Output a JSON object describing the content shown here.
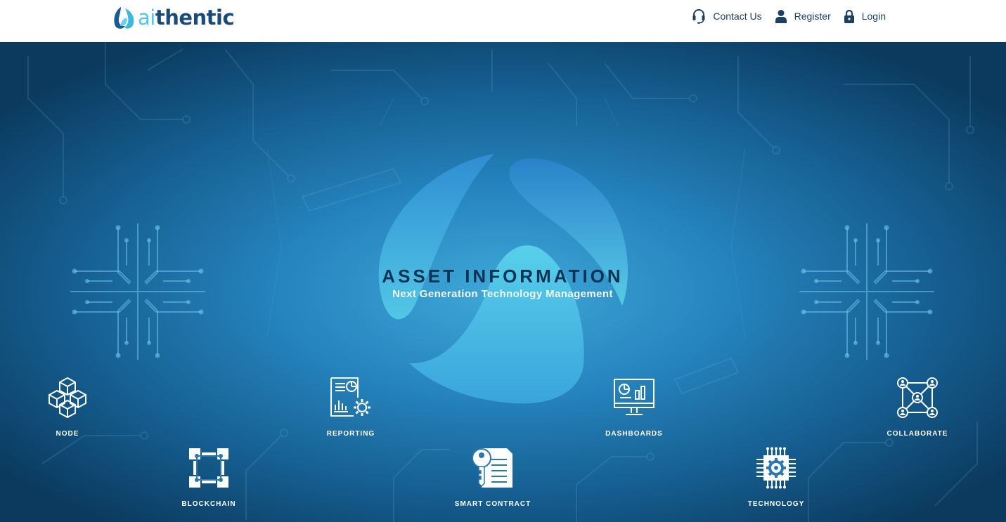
{
  "brand": {
    "logo_ai": "ai",
    "logo_rest": "thentic"
  },
  "nav": [
    {
      "label": "Contact Us",
      "icon": "headset-icon"
    },
    {
      "label": "Register",
      "icon": "user-icon"
    },
    {
      "label": "Login",
      "icon": "lock-icon"
    }
  ],
  "hero": {
    "title": "ASSET INFORMATION",
    "subtitle": "Next Generation Technology Management"
  },
  "features": [
    {
      "label": "NODE",
      "icon": "cubes-icon"
    },
    {
      "label": "REPORTING",
      "icon": "report-gear-icon"
    },
    {
      "label": "DASHBOARDS",
      "icon": "monitor-chart-icon"
    },
    {
      "label": "COLLABORATE",
      "icon": "network-people-icon"
    },
    {
      "label": "BLOCKCHAIN",
      "icon": "blockchain-nodes-icon"
    },
    {
      "label": "SMART CONTRACT",
      "icon": "key-document-icon"
    },
    {
      "label": "TECHNOLOGY",
      "icon": "chip-gear-icon"
    }
  ],
  "colors": {
    "brand_dark": "#1a4a78",
    "brand_light": "#4fc8e6",
    "hero_dark": "#0b3a5e",
    "hero_mid": "#2684be"
  }
}
